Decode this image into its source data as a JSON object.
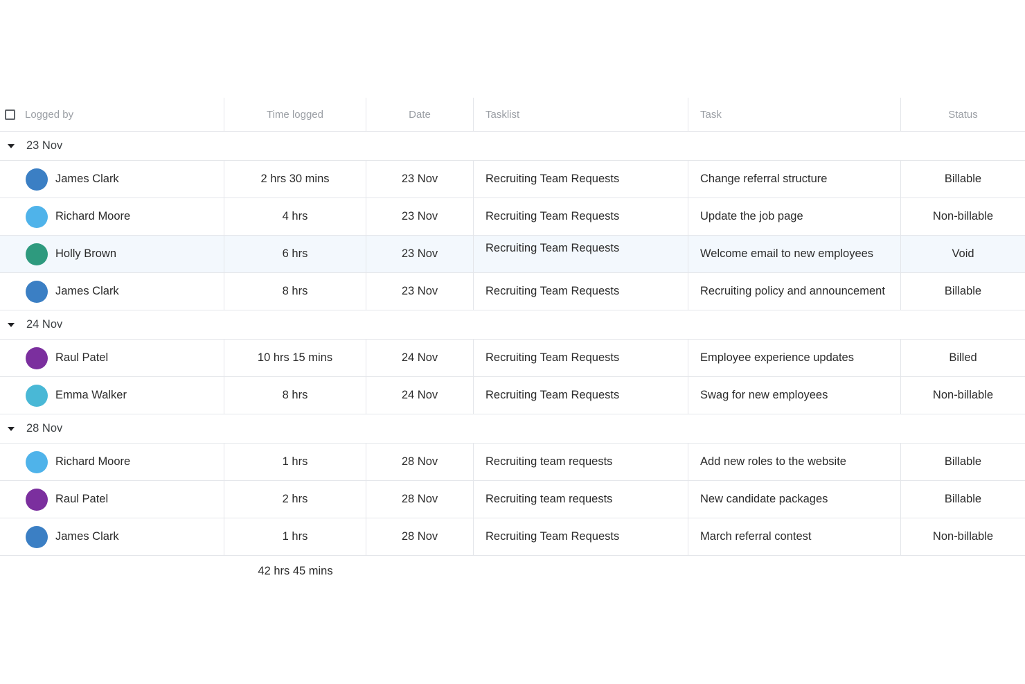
{
  "columns": {
    "logged_by": "Logged by",
    "time_logged": "Time logged",
    "date": "Date",
    "tasklist": "Tasklist",
    "task": "Task",
    "status": "Status"
  },
  "groups": [
    {
      "label": "23 Nov",
      "rows": [
        {
          "name": "James Clark",
          "avatar_color": "#3b7fc4",
          "time": "2 hrs 30 mins",
          "date": "23 Nov",
          "tasklist": "Recruiting Team Requests",
          "task": "Change referral structure",
          "status": "Billable"
        },
        {
          "name": "Richard Moore",
          "avatar_color": "#4fb3ea",
          "time": "4 hrs",
          "date": "23 Nov",
          "tasklist": "Recruiting Team Requests",
          "task": "Update the job page",
          "status": "Non-billable"
        },
        {
          "name": "Holly Brown",
          "avatar_color": "#2e9a7e",
          "time": "6 hrs",
          "date": "23 Nov",
          "tasklist": "Recruiting Team Requests",
          "task": "Welcome email to new employees",
          "status": "Void"
        },
        {
          "name": "James Clark",
          "avatar_color": "#3b7fc4",
          "time": "8 hrs",
          "date": "23 Nov",
          "tasklist": "Recruiting Team Requests",
          "task": "Recruiting policy and announcement",
          "status": "Billable"
        }
      ]
    },
    {
      "label": "24 Nov",
      "rows": [
        {
          "name": "Raul Patel",
          "avatar_color": "#7b2f9e",
          "time": "10 hrs 15 mins",
          "date": "24 Nov",
          "tasklist": "Recruiting Team Requests",
          "task": "Employee experience updates",
          "status": "Billed"
        },
        {
          "name": "Emma Walker",
          "avatar_color": "#49b8d6",
          "time": "8 hrs",
          "date": "24 Nov",
          "tasklist": "Recruiting Team Requests",
          "task": "Swag for new employees",
          "status": "Non-billable"
        }
      ]
    },
    {
      "label": "28 Nov",
      "rows": [
        {
          "name": "Richard Moore",
          "avatar_color": "#4fb3ea",
          "time": "1 hrs",
          "date": "28 Nov",
          "tasklist": "Recruiting team requests",
          "task": "Add new roles to the website",
          "status": "Billable"
        },
        {
          "name": "Raul Patel",
          "avatar_color": "#7b2f9e",
          "time": "2 hrs",
          "date": "28 Nov",
          "tasklist": "Recruiting team requests",
          "task": "New candidate packages",
          "status": "Billable"
        },
        {
          "name": "James Clark",
          "avatar_color": "#3b7fc4",
          "time": "1 hrs",
          "date": "28 Nov",
          "tasklist": "Recruiting Team Requests",
          "task": "March referral contest",
          "status": "Non-billable"
        }
      ]
    }
  ],
  "total": "42 hrs 45 mins",
  "colors": {
    "highlight_row": "#f3f8fd",
    "border": "#e4e6ea",
    "header_text": "#9a9ea4"
  }
}
